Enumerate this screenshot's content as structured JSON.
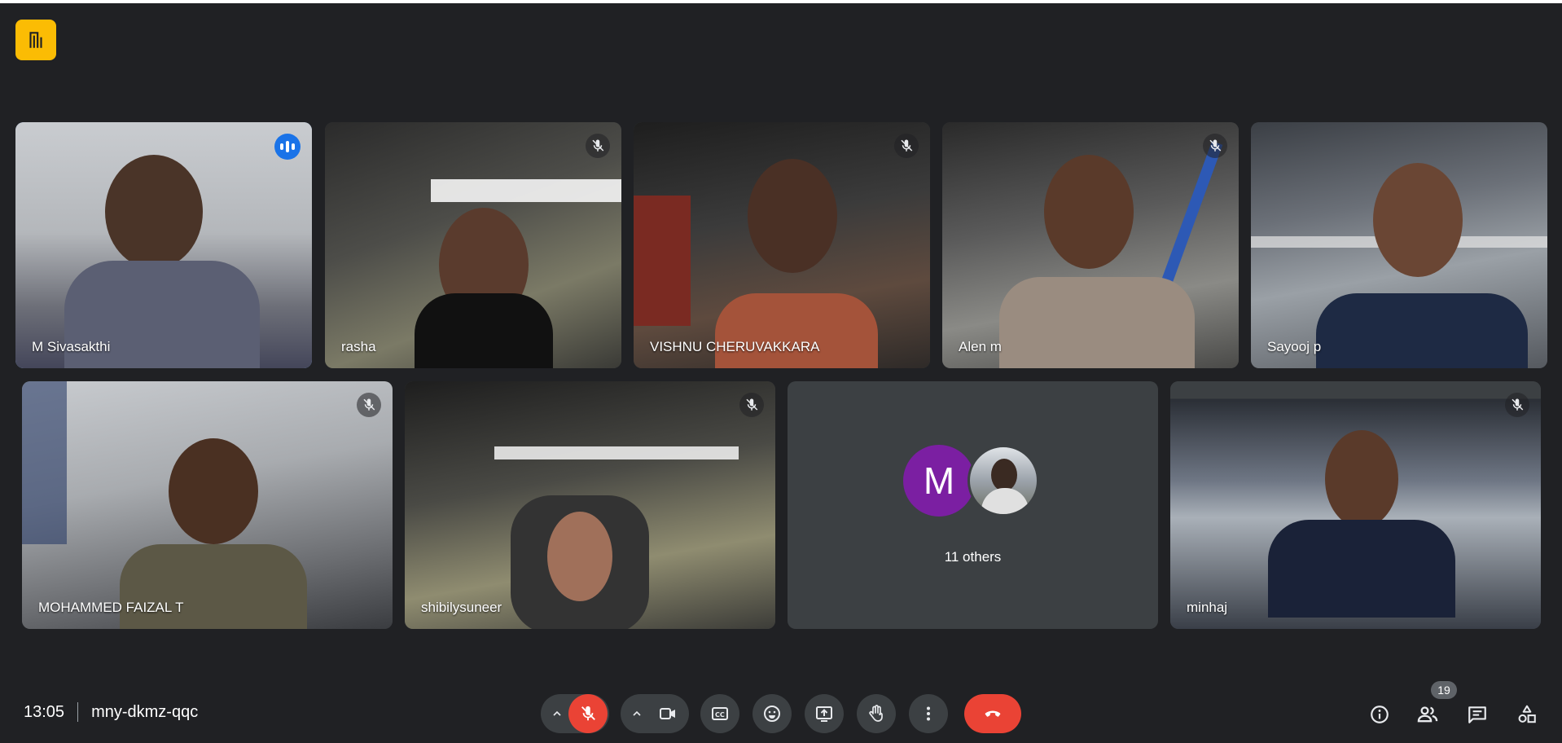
{
  "meeting": {
    "time": "13:05",
    "code": "mny-dkmz-qqc"
  },
  "participants": [
    {
      "name": "M Sivasakthi",
      "status": "speaking"
    },
    {
      "name": "rasha",
      "status": "muted"
    },
    {
      "name": "VISHNU CHERUVAKKARA",
      "status": "muted"
    },
    {
      "name": "Alen m",
      "status": "muted"
    },
    {
      "name": "Sayooj p",
      "status": "unmuted"
    },
    {
      "name": "MOHAMMED FAIZAL T",
      "status": "muted"
    },
    {
      "name": "shibilysuneer",
      "status": "muted"
    },
    {
      "name": "minhaj",
      "status": "muted"
    }
  ],
  "others_tile": {
    "avatar_letter": "M",
    "label": "11 others"
  },
  "people_count": "19",
  "colors": {
    "background": "#202124",
    "tile": "#3c4043",
    "accent": "#8ab4f8",
    "danger": "#ea4335",
    "logo": "#fbbc04",
    "avatar": "#7b1fa2"
  },
  "icons": {
    "logo": "door-icon",
    "mic": "mic-off-icon",
    "camera": "videocam-icon",
    "captions": "closed-caption-icon",
    "reactions": "emoji-icon",
    "present": "present-screen-icon",
    "raise_hand": "hand-icon",
    "more": "more-vert-icon",
    "end": "call-end-icon",
    "info": "info-icon",
    "people": "people-icon",
    "chat": "chat-icon",
    "activities": "shapes-icon"
  }
}
